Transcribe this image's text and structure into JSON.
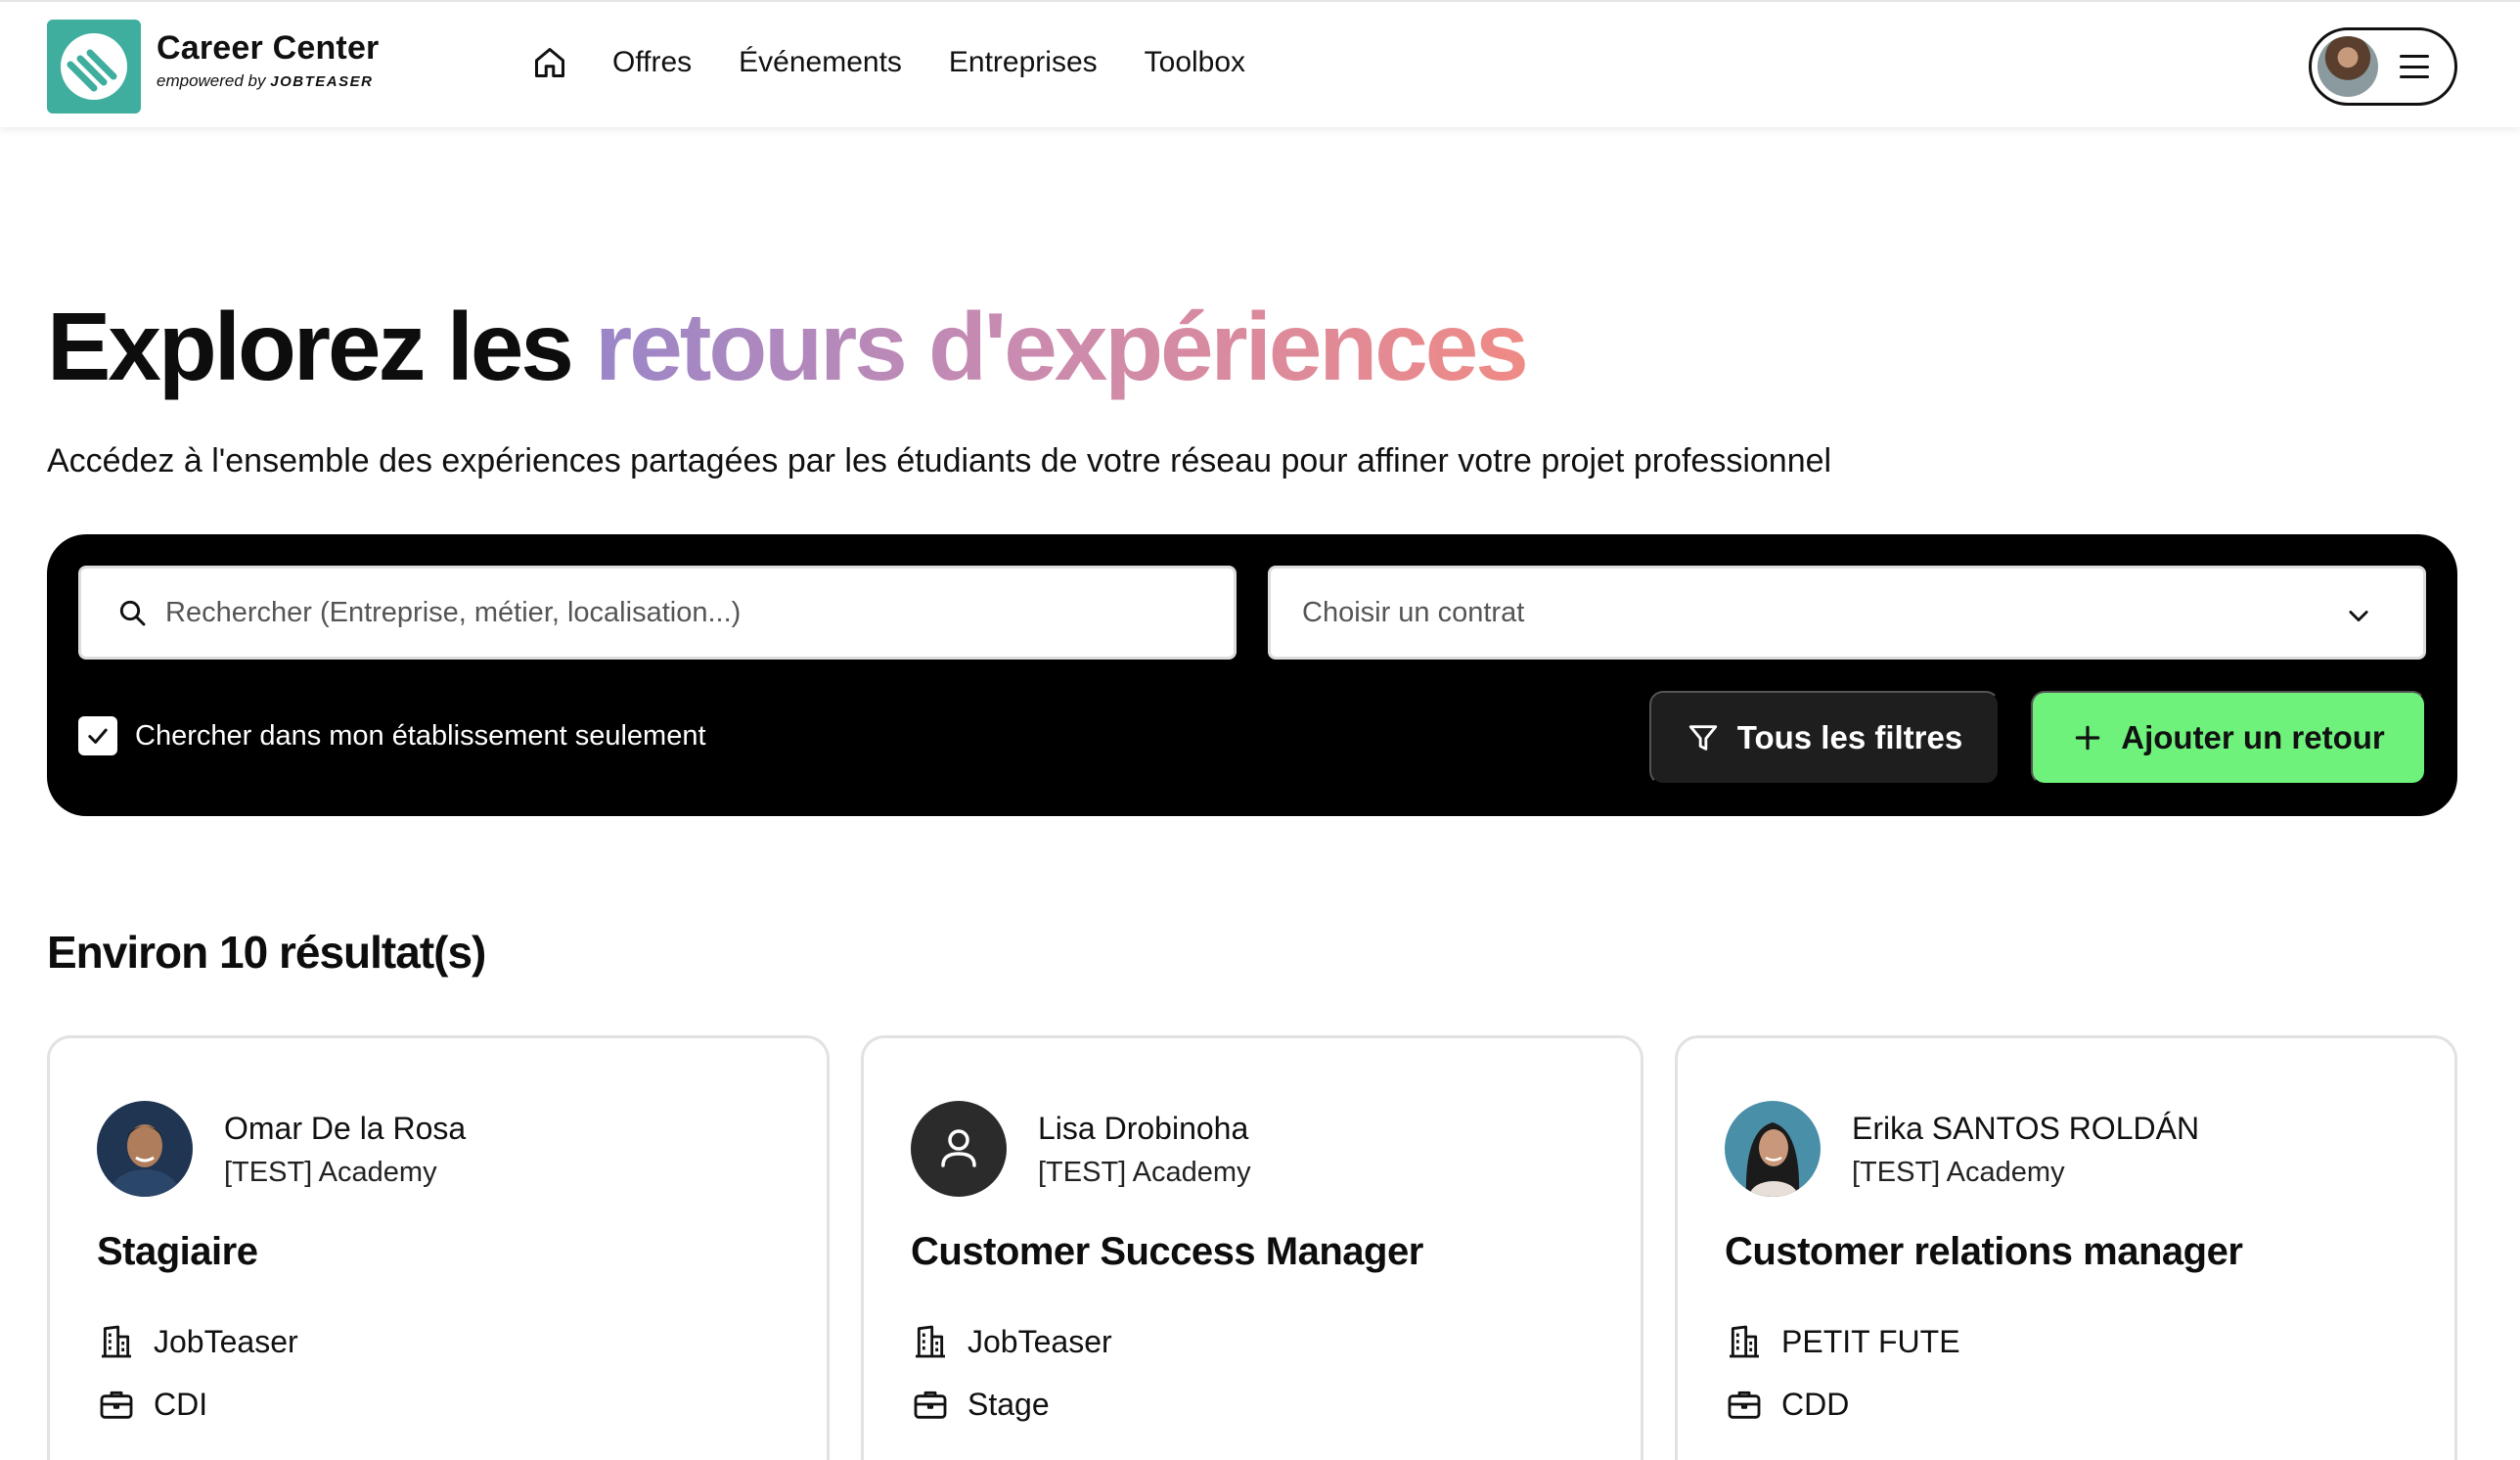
{
  "header": {
    "logo_title": "Career Center",
    "logo_sub_prefix": "empowered by",
    "logo_sub_brand": "JOBTEASER",
    "nav": [
      "Offres",
      "Événements",
      "Entreprises",
      "Toolbox"
    ]
  },
  "hero": {
    "title_plain": "Explorez les ",
    "title_highlight": "retours d'expériences",
    "subtitle": "Accédez à l'ensemble des expériences partagées par les étudiants de votre réseau pour affiner votre projet professionnel"
  },
  "search": {
    "placeholder": "Rechercher (Entreprise, métier, localisation...)",
    "contract_placeholder": "Choisir un contrat",
    "checkbox_label": "Chercher dans mon établissement seulement",
    "checkbox_checked": true,
    "filters_label": "Tous les filtres",
    "add_label": "Ajouter un retour"
  },
  "results": {
    "count_label": "Environ 10 résultat(s)",
    "cards": [
      {
        "name": "Omar De la Rosa",
        "school": "[TEST] Academy",
        "role": "Stagiaire",
        "company": "JobTeaser",
        "contract": "CDI",
        "avatar": "photo"
      },
      {
        "name": "Lisa Drobinoha",
        "school": "[TEST] Academy",
        "role": "Customer Success Manager",
        "company": "JobTeaser",
        "contract": "Stage",
        "avatar": "placeholder-user-icon"
      },
      {
        "name": "Erika SANTOS ROLDÁN",
        "school": "[TEST] Academy",
        "role": "Customer relations manager",
        "company": "PETIT FUTE",
        "contract": "CDD",
        "avatar": "photo"
      }
    ]
  },
  "colors": {
    "panel_bg": "#000000",
    "accent_green": "#6ff27c",
    "logo_teal": "#3fae9e",
    "gradient_start": "#9a86c8",
    "gradient_end": "#ef8a86"
  }
}
